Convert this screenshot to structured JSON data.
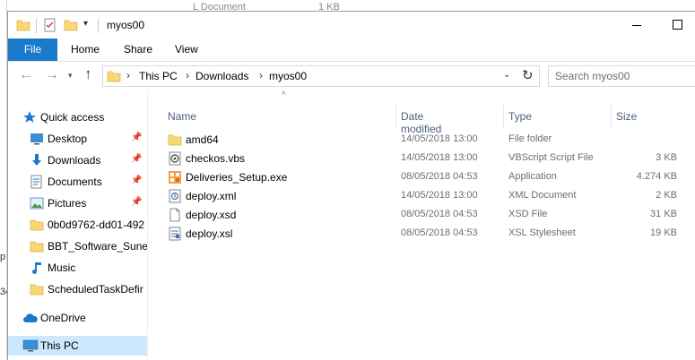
{
  "background": {
    "text1": "L Document",
    "text2": "1 KB",
    "edge1": "p",
    "edge2": "34"
  },
  "window": {
    "title": "myos00"
  },
  "ribbon": {
    "tabs": [
      "File",
      "Home",
      "Share",
      "View"
    ]
  },
  "address": {
    "crumbs": [
      "This PC",
      "Downloads",
      "myos00"
    ]
  },
  "search": {
    "placeholder": "Search myos00"
  },
  "sidebar": {
    "items": [
      {
        "label": "Quick access",
        "icon": "star-icon",
        "pinned": false
      },
      {
        "label": "Desktop",
        "icon": "desktop-icon",
        "pinned": true
      },
      {
        "label": "Downloads",
        "icon": "download-arrow-icon",
        "pinned": true
      },
      {
        "label": "Documents",
        "icon": "documents-icon",
        "pinned": true
      },
      {
        "label": "Pictures",
        "icon": "pictures-icon",
        "pinned": true
      },
      {
        "label": "0b0d9762-dd01-492",
        "icon": "folder-icon",
        "pinned": false
      },
      {
        "label": "BBT_Software_Sune",
        "icon": "folder-icon",
        "pinned": false
      },
      {
        "label": "Music",
        "icon": "music-note-icon",
        "pinned": false
      },
      {
        "label": "ScheduledTaskDefir",
        "icon": "folder-icon",
        "pinned": false
      },
      {
        "label": "OneDrive",
        "icon": "cloud-icon",
        "pinned": false
      },
      {
        "label": "This PC",
        "icon": "computer-icon",
        "pinned": false,
        "selected": true
      }
    ]
  },
  "columns": {
    "name": "Name",
    "date": "Date modified",
    "type": "Type",
    "size": "Size"
  },
  "files": [
    {
      "name": "amd64",
      "date": "14/05/2018 13:00",
      "type": "File folder",
      "size": "",
      "icon": "folder-icon"
    },
    {
      "name": "checkos.vbs",
      "date": "14/05/2018 13:00",
      "type": "VBScript Script File",
      "size": "3 KB",
      "icon": "vbscript-file-icon"
    },
    {
      "name": "Deliveries_Setup.exe",
      "date": "08/05/2018 04:53",
      "type": "Application",
      "size": "4.274 KB",
      "icon": "installer-icon"
    },
    {
      "name": "deploy.xml",
      "date": "14/05/2018 13:00",
      "type": "XML Document",
      "size": "2 KB",
      "icon": "xml-file-icon"
    },
    {
      "name": "deploy.xsd",
      "date": "08/05/2018 04:53",
      "type": "XSD File",
      "size": "31 KB",
      "icon": "blank-file-icon"
    },
    {
      "name": "deploy.xsl",
      "date": "08/05/2018 04:53",
      "type": "XSL Stylesheet",
      "size": "19 KB",
      "icon": "xsl-file-icon"
    }
  ],
  "colors": {
    "accent": "#1979ca",
    "folder": "#f8d775",
    "selection": "#cce8ff",
    "header_text": "#4d6082"
  }
}
